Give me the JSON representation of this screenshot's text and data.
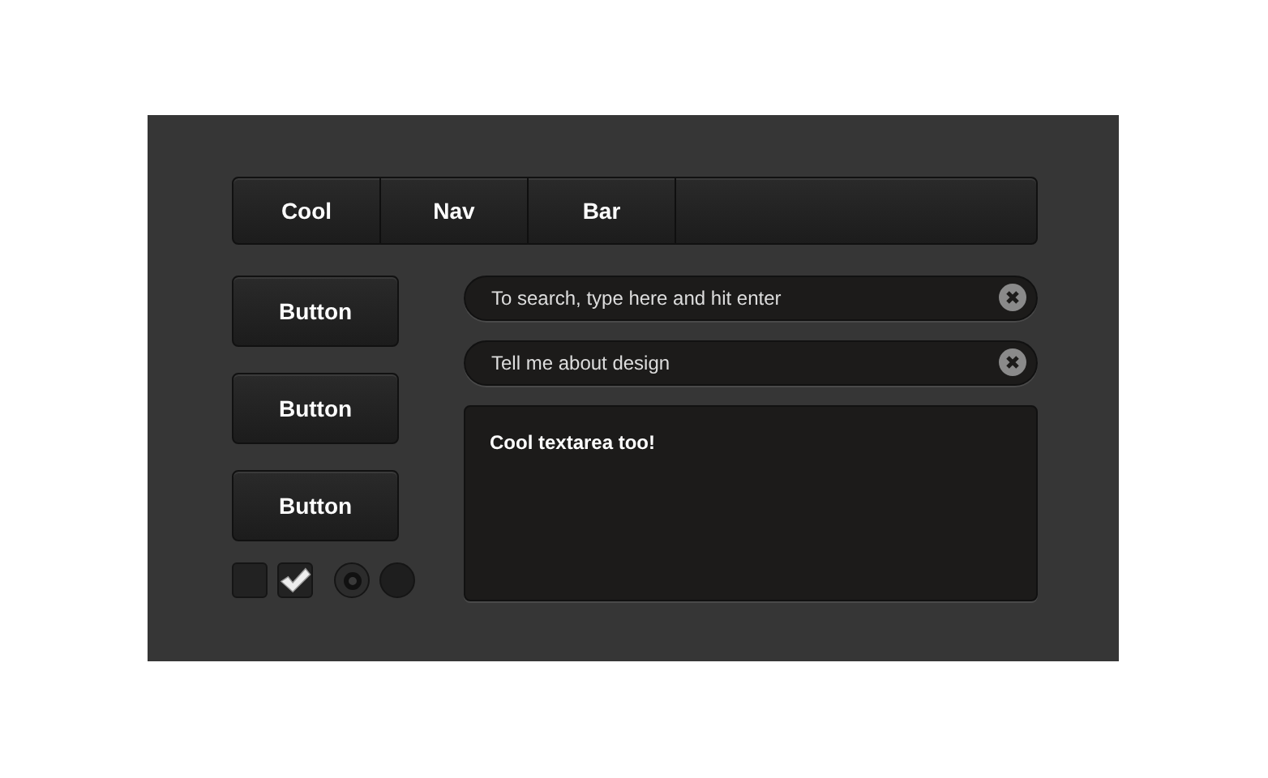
{
  "nav": {
    "items": [
      {
        "label": "Cool"
      },
      {
        "label": "Nav"
      },
      {
        "label": "Bar"
      }
    ]
  },
  "buttons": [
    "Button",
    "Button",
    "Button"
  ],
  "checkboxes": [
    {
      "checked": false
    },
    {
      "checked": true
    }
  ],
  "radios": [
    {
      "selected": true
    },
    {
      "selected": false
    }
  ],
  "search_fields": [
    {
      "placeholder": "To search, type here and hit enter"
    },
    {
      "value": "Tell me about design"
    }
  ],
  "textarea": {
    "value": "Cool textarea too!"
  }
}
